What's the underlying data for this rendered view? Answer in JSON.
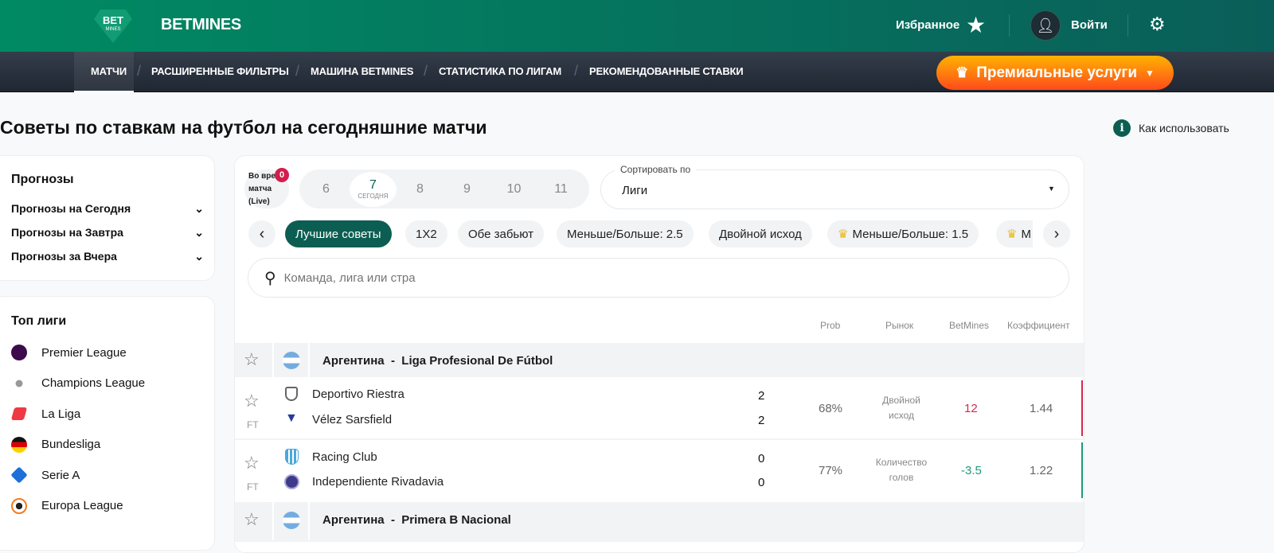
{
  "header": {
    "logo_text": "BET MINES",
    "brand": "BETMINES",
    "favorites": "Избранное",
    "login": "Войти"
  },
  "nav": {
    "items": [
      "МАТЧИ",
      "РАСШИРЕННЫЕ ФИЛЬТРЫ",
      "МАШИНА BETMINES",
      "СТАТИСТИКА ПО ЛИГАМ",
      "РЕКОМЕНДОВАННЫЕ СТАВКИ"
    ],
    "premium": "Премиальные услуги"
  },
  "page": {
    "title": "Советы по ставкам на футбол на сегодняшние матчи",
    "howto": "Как использовать"
  },
  "sidebar": {
    "forecasts_title": "Прогнозы",
    "forecasts": [
      "Прогнозы на Сегодня",
      "Прогнозы на Завтра",
      "Прогнозы за Вчера"
    ],
    "top_title": "Топ лиги",
    "leagues": [
      "Premier League",
      "Champions League",
      "La Liga",
      "Bundesliga",
      "Serie A",
      "Europa League"
    ]
  },
  "filters": {
    "live_line1": "Во вре",
    "live_line2": "матча",
    "live_line3": "(Live)",
    "live_count": "0",
    "dates": [
      "6",
      "7",
      "8",
      "9",
      "10",
      "11"
    ],
    "today_label": "СЕГОДНЯ",
    "sort_label": "Сортировать по",
    "sort_value": "Лиги",
    "chips": [
      "Лучшие советы",
      "1X2",
      "Обе забьют",
      "Меньше/Больше: 2.5",
      "Двойной исход",
      "Меньше/Больше: 1.5",
      "М"
    ],
    "search_placeholder": "Команда, лига или стра"
  },
  "table": {
    "headers": [
      "Prob",
      "Рынок",
      "BetMines",
      "Коэффициент"
    ],
    "groups": [
      {
        "country": "Аргентина",
        "league": "Liga Profesional De Fútbol"
      },
      {
        "country": "Аргентина",
        "league": "Primera B Nacional"
      }
    ],
    "matches": [
      {
        "home": "Deportivo Riestra",
        "away": "Vélez Sarsfield",
        "home_score": "2",
        "away_score": "2",
        "status": "FT",
        "prob": "68%",
        "market1": "Двойной",
        "market2": "исход",
        "betmines": "12",
        "odds": "1.44",
        "color": "#d6284f"
      },
      {
        "home": "Racing Club",
        "away": "Independiente Rivadavia",
        "home_score": "0",
        "away_score": "0",
        "status": "FT",
        "prob": "77%",
        "market1": "Количество",
        "market2": "голов",
        "betmines": "-3.5",
        "odds": "1.22",
        "color": "#1a9a78"
      }
    ]
  }
}
